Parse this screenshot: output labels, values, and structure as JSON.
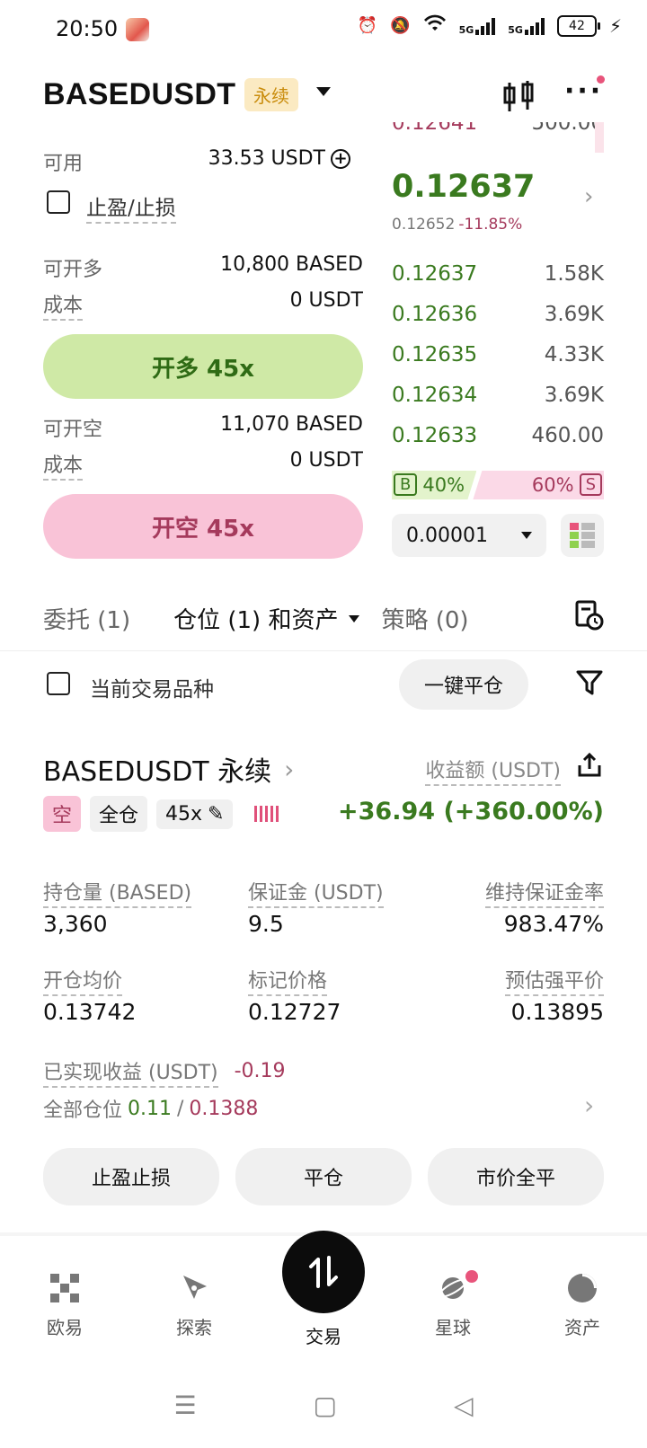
{
  "status_bar": {
    "time": "20:50",
    "net1": "5G",
    "net2": "5G",
    "battery": "42"
  },
  "header": {
    "symbol": "BASEDUSDT",
    "contract_type": "永续"
  },
  "order_form": {
    "available_label": "可用",
    "available_value": "33.53 USDT",
    "tp_sl_label": "止盈/止损",
    "long": {
      "label": "可开多",
      "value": "10,800 BASED",
      "cost_label": "成本",
      "cost_value": "0 USDT",
      "button": "开多 45x"
    },
    "short": {
      "label": "可开空",
      "value": "11,070 BASED",
      "cost_label": "成本",
      "cost_value": "0 USDT",
      "button": "开空 45x"
    }
  },
  "orderbook": {
    "top_ask_price": "0.12641",
    "top_ask_size": "500.00",
    "last_price": "0.12637",
    "mark_price": "0.12652",
    "change": "-11.85%",
    "bids": [
      {
        "price": "0.12637",
        "size": "1.58K",
        "depth": 0.14
      },
      {
        "price": "0.12636",
        "size": "3.69K",
        "depth": 0.33
      },
      {
        "price": "0.12635",
        "size": "4.33K",
        "depth": 0.39
      },
      {
        "price": "0.12634",
        "size": "3.69K",
        "depth": 0.33
      },
      {
        "price": "0.12633",
        "size": "460.00",
        "depth": 0.04
      }
    ],
    "buy_label": "B",
    "buy_pct": "40%",
    "sell_pct": "60%",
    "sell_label": "S",
    "buy_ratio": 0.4,
    "tick_size": "0.00001"
  },
  "tabs": {
    "orders": "委托 (1)",
    "positions": "仓位 (1) 和资产",
    "strategies": "策略 (0)"
  },
  "filter": {
    "current_symbol_label": "当前交易品种",
    "close_all": "一键平仓"
  },
  "position": {
    "title": "BASEDUSDT 永续",
    "pnl_label": "收益额 (USDT)",
    "side_tag": "空",
    "margin_tag": "全仓",
    "leverage_tag": "45x",
    "pnl_value": "+36.94 (+360.00%)",
    "size_label": "持仓量 (BASED)",
    "size_value": "3,360",
    "margin_label": "保证金 (USDT)",
    "margin_value": "9.5",
    "mmr_label": "维持保证金率",
    "mmr_value": "983.47%",
    "entry_label": "开仓均价",
    "entry_value": "0.13742",
    "mark_label": "标记价格",
    "mark_value": "0.12727",
    "liq_label": "预估强平价",
    "liq_value": "0.13895",
    "realized_label": "已实现收益 (USDT)",
    "realized_value": "-0.19",
    "all_pos_label": "全部仓位",
    "all_pos_a": "0.11",
    "all_pos_sep": "/",
    "all_pos_b": "0.1388",
    "buttons": [
      "止盈止损",
      "平仓",
      "市价全平"
    ]
  },
  "nav": [
    "欧易",
    "探索",
    "交易",
    "星球",
    "资产"
  ],
  "colors": {
    "green": "#3a7a1f",
    "red": "#a53a5c",
    "long_bg": "#cfe9a6",
    "short_bg": "#f9c3d7"
  }
}
